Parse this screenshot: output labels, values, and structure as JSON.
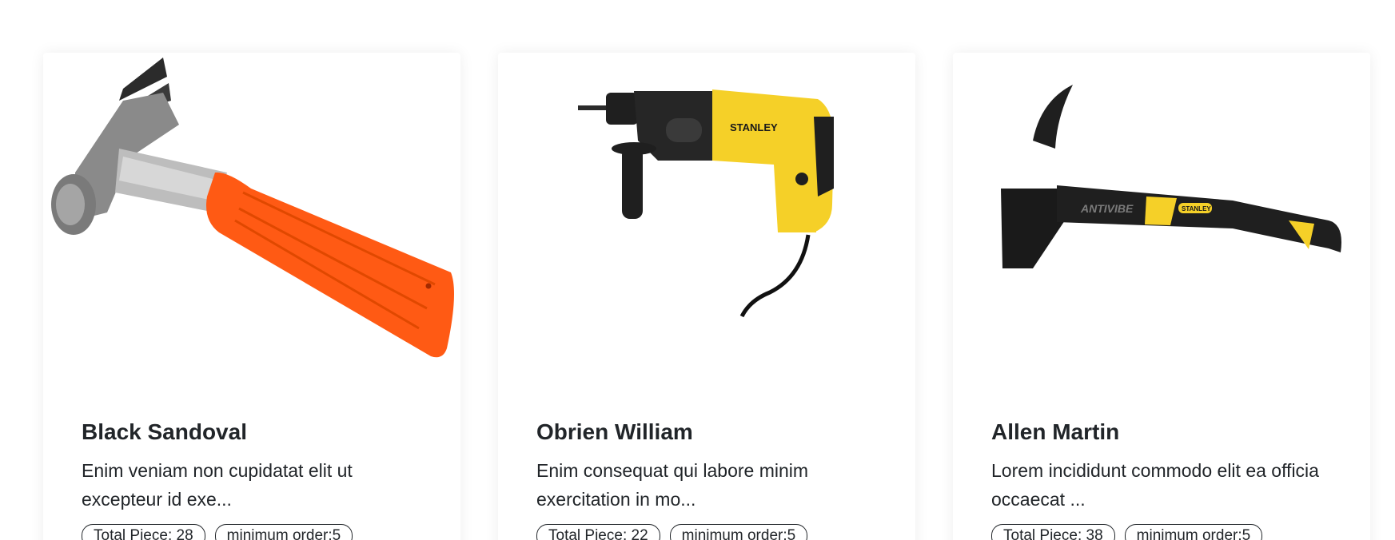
{
  "products": [
    {
      "title": "Black Sandoval",
      "description": "Enim veniam non cupidatat elit ut excepteur id exe...",
      "total_piece": "Total Piece: 28",
      "minimum_order": "minimum order:5",
      "image_icon": "claw-hammer-orange-icon"
    },
    {
      "title": "Obrien William",
      "description": "Enim consequat qui labore minim exercitation in mo...",
      "total_piece": "Total Piece: 22",
      "minimum_order": "minimum order:5",
      "image_icon": "rotary-hammer-drill-icon",
      "brand_text": "STANLEY"
    },
    {
      "title": "Allen Martin",
      "description": "Lorem incididunt commodo elit ea officia occaecat ...",
      "total_piece": "Total Piece: 38",
      "minimum_order": "minimum order:5",
      "image_icon": "antivibe-hammer-icon",
      "brand_text": "ANTIVIBE",
      "brand_text_2": "STANLEY"
    }
  ],
  "colors": {
    "orange_grip": "#ff5a14",
    "stanley_yellow": "#f5d028",
    "tool_black": "#1f1f1f",
    "steel": "#9a9a9a"
  }
}
